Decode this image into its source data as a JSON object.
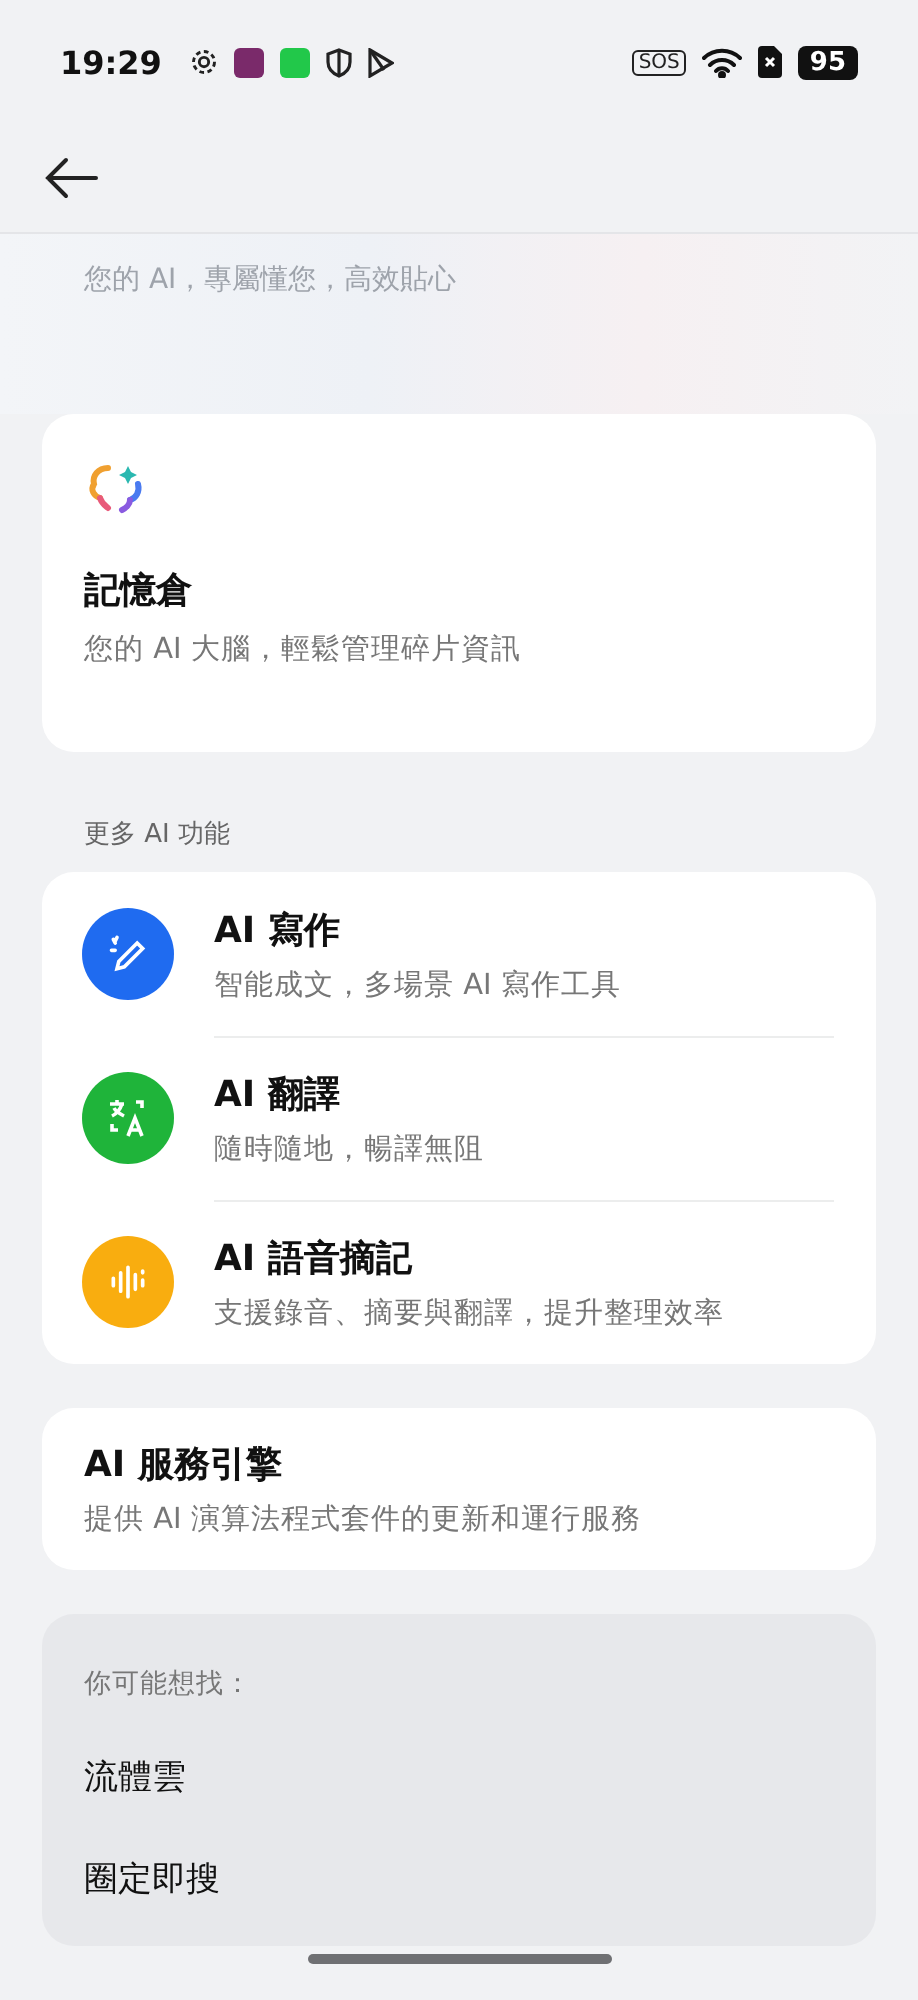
{
  "status_bar": {
    "time": "19:29",
    "sos": "SOS",
    "battery": "95"
  },
  "header": {
    "tagline": "您的 AI，專屬懂您，高效貼心"
  },
  "memory_card": {
    "title": "記憶倉",
    "subtitle": "您的 AI 大腦，輕鬆管理碎片資訊"
  },
  "section_label": "更多 AI 功能",
  "features": [
    {
      "kind": "writing",
      "title": "AI 寫作",
      "subtitle": "智能成文，多場景 AI 寫作工具",
      "color": "#1f6bf0"
    },
    {
      "kind": "translate",
      "title": "AI 翻譯",
      "subtitle": "隨時隨地，暢譯無阻",
      "color": "#1fb43a"
    },
    {
      "kind": "voice",
      "title": "AI 語音摘記",
      "subtitle": "支援錄音、摘要與翻譯，提升整理效率",
      "color": "#f9ad0f"
    }
  ],
  "engine_card": {
    "title": "AI 服務引擎",
    "subtitle": "提供 AI 演算法程式套件的更新和運行服務"
  },
  "suggestions": {
    "label": "你可能想找：",
    "items": [
      "流體雲",
      "圈定即搜"
    ]
  }
}
